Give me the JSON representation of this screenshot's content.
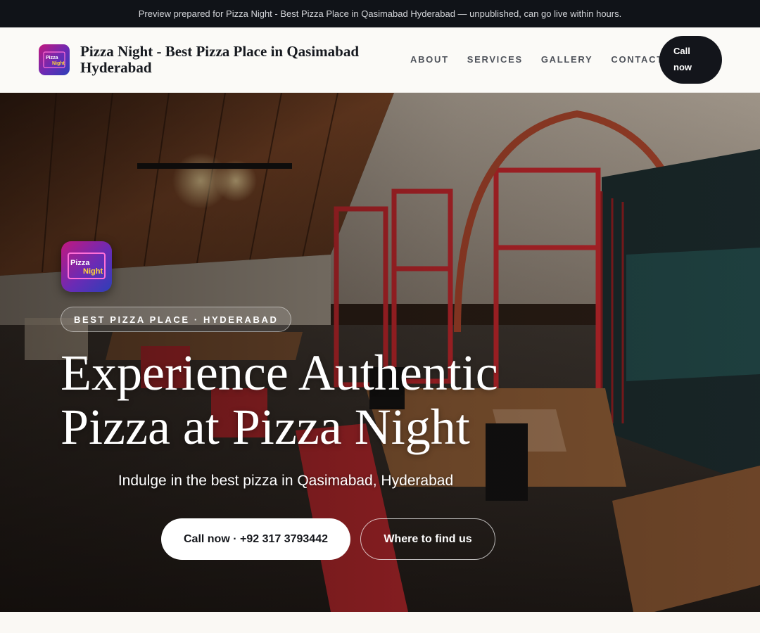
{
  "banner": {
    "text": "Preview prepared for Pizza Night - Best Pizza Place in Qasimabad Hyderabad — unpublished, can go live within hours."
  },
  "header": {
    "brand_name": "Pizza Night - Best Pizza Place in Qasimabad Hyderabad",
    "logo_text_top": "Pizza",
    "logo_text_bottom": "Night",
    "nav": [
      "ABOUT",
      "SERVICES",
      "GALLERY",
      "CONTACT"
    ],
    "call_button": "Call now"
  },
  "hero": {
    "eyebrow": "BEST PIZZA PLACE · HYDERABAD",
    "headline": "Experience Authentic Pizza at Pizza Night",
    "subline": "Indulge in the best pizza in Qasimabad, Hyderabad",
    "primary_button": "Call now · +92 317 3793442",
    "secondary_button": "Where to find us"
  },
  "colors": {
    "banner_bg": "#101318",
    "header_bg": "#fbfaf7",
    "accent_dark": "#13151b",
    "door_red": "#c4262c",
    "wood": "#7a4524"
  }
}
